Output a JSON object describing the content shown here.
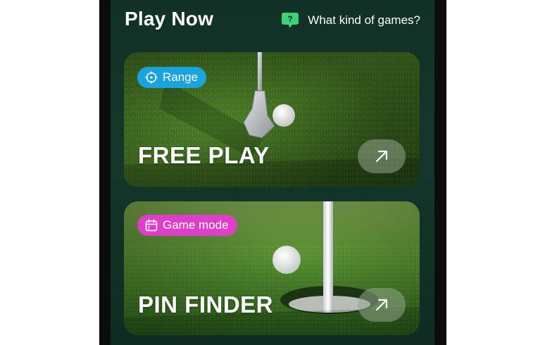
{
  "header": {
    "title": "Play Now",
    "help_text": "What kind of games?",
    "help_icon": "question-speech-bubble-icon"
  },
  "cards": [
    {
      "tag_label": "Range",
      "tag_icon": "crosshair-icon",
      "tag_color": "#1aa3dc",
      "title": "FREE PLAY",
      "action_icon": "arrow-up-right-icon"
    },
    {
      "tag_label": "Game mode",
      "tag_icon": "calendar-icon",
      "tag_color": "#dd3fc8",
      "title": "PIN FINDER",
      "action_icon": "arrow-up-right-icon"
    }
  ],
  "colors": {
    "background": "#14362a",
    "help_icon_green": "#3fd07a",
    "arrow_button": "#8f9f88"
  }
}
